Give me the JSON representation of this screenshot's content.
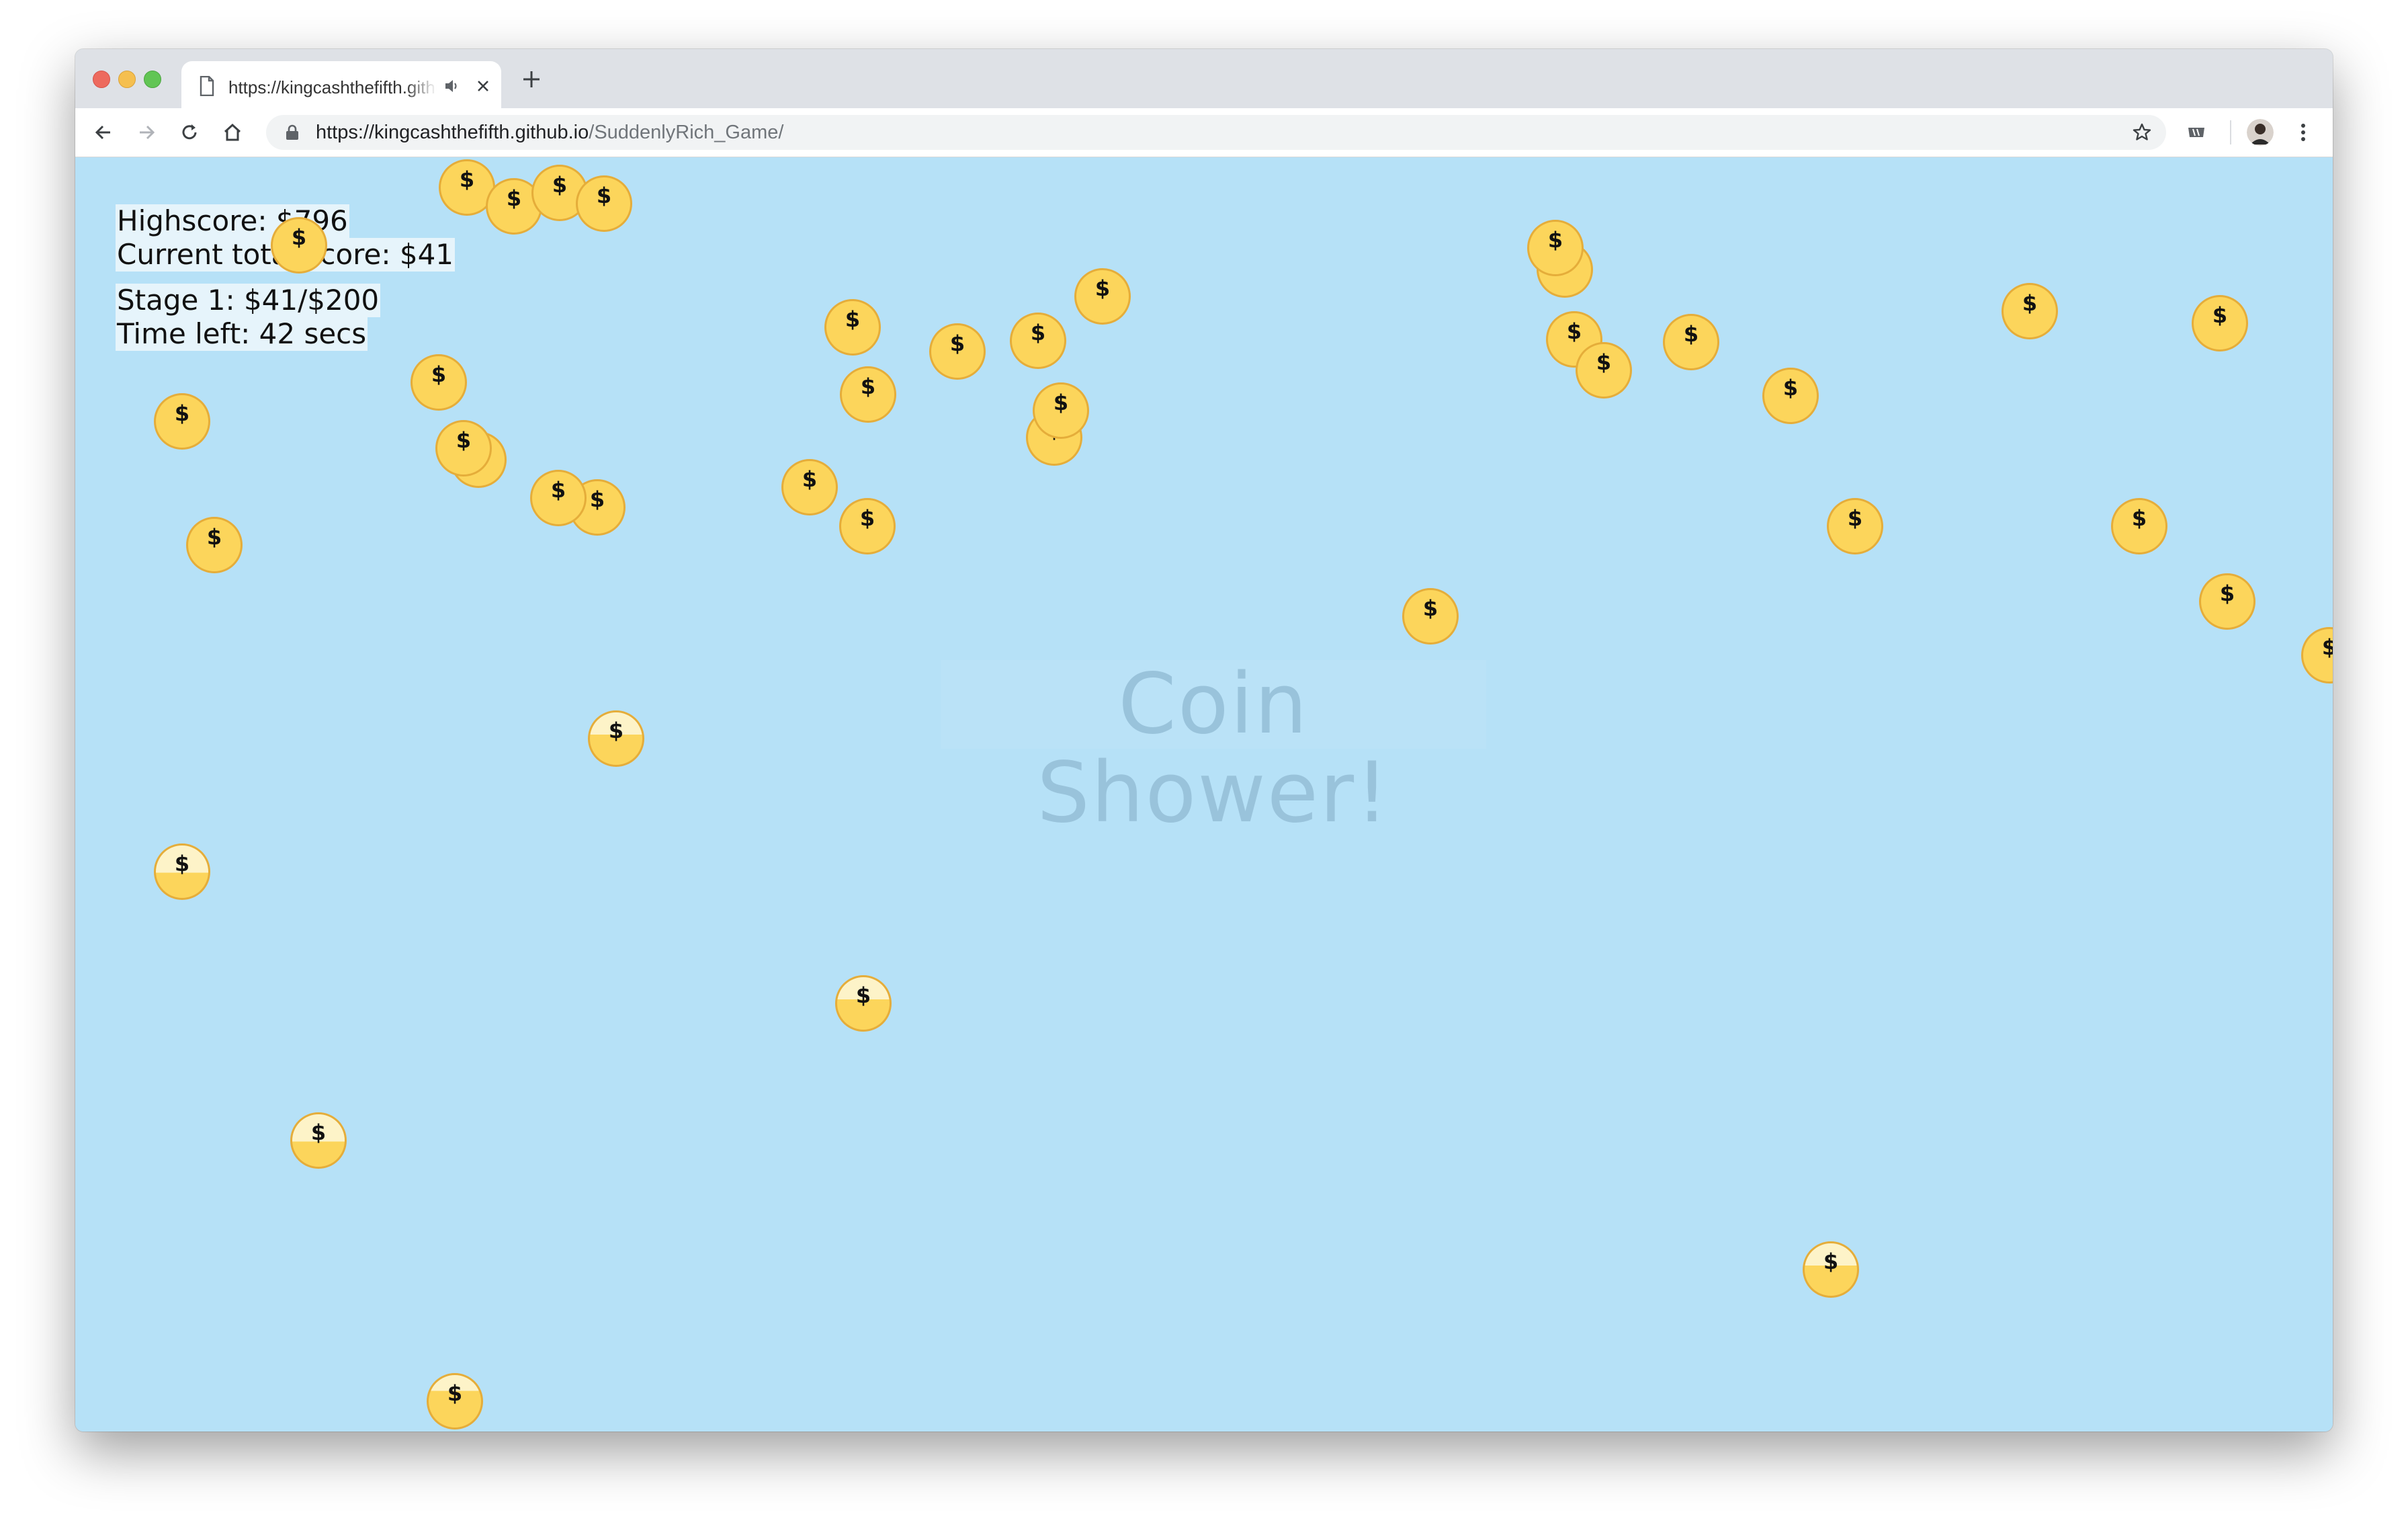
{
  "browser": {
    "tab_title": "https://kingcashthefifth.github.io/SuddenlyRich_Game/",
    "url_host": "https://kingcashthefifth.github.io",
    "url_path": "/SuddenlyRich_Game/"
  },
  "game": {
    "highscore": "Highscore: $796",
    "current_total": "Current total score: $41",
    "stage": "Stage 1: $41/$200",
    "time_left": "Time left: 42 secs",
    "title": "Coin Shower!",
    "coin_symbol": "$"
  },
  "colors": {
    "background": "#b6e1f7",
    "coin": "#fcd55b",
    "coin_border": "#e5ad3a",
    "title_text": "#99c3db"
  }
}
